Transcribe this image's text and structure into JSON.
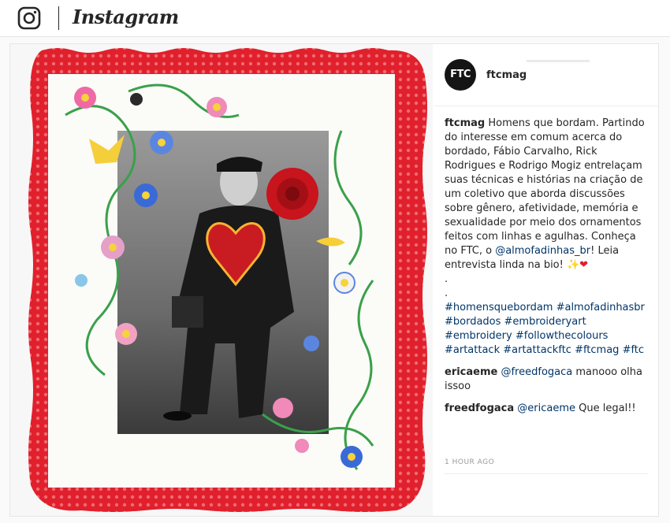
{
  "header": {
    "brand": "Instagram",
    "logo_icon": "instagram-camera-icon"
  },
  "post": {
    "author": {
      "avatar_text": "FTC",
      "username": "ftcmag"
    },
    "caption": {
      "username": "ftcmag",
      "text_1": "Homens que bordam. Partindo do interesse em comum acerca do bordado, Fábio Carvalho, Rick Rodrigues e Rodrigo Mogiz entrelaçam suas técnicas e histórias na criação de um coletivo que aborda discussões sobre gênero, afetividade, memória e sexualidade por meio dos ornamentos feitos com linhas e agulhas. Conheça no FTC, o ",
      "mention": "@almofadinhas_br",
      "text_2": "! Leia entrevista linda na bio! ",
      "emoji_1": "✨",
      "emoji_2": "❤",
      "dot_1": ".",
      "dot_2": ".",
      "hashtags": "#homensquebordam #almofadinhasbr #bordados #embroideryart #embroidery #followthecolours #artattack #artattackftc #ftcmag #ftc"
    },
    "comments": [
      {
        "username": "ericaeme",
        "mention": "@freedfogaca",
        "text": " manooo olha issoo"
      },
      {
        "username": "freedfogaca",
        "mention": "@ericaeme",
        "text": " Que legal!!"
      }
    ],
    "timestamp": "1 HOUR AGO"
  },
  "colors": {
    "frame_red": "#e0202c",
    "rose_red": "#c8141c",
    "leaf_green": "#3aa04a",
    "link_blue": "#003569"
  }
}
